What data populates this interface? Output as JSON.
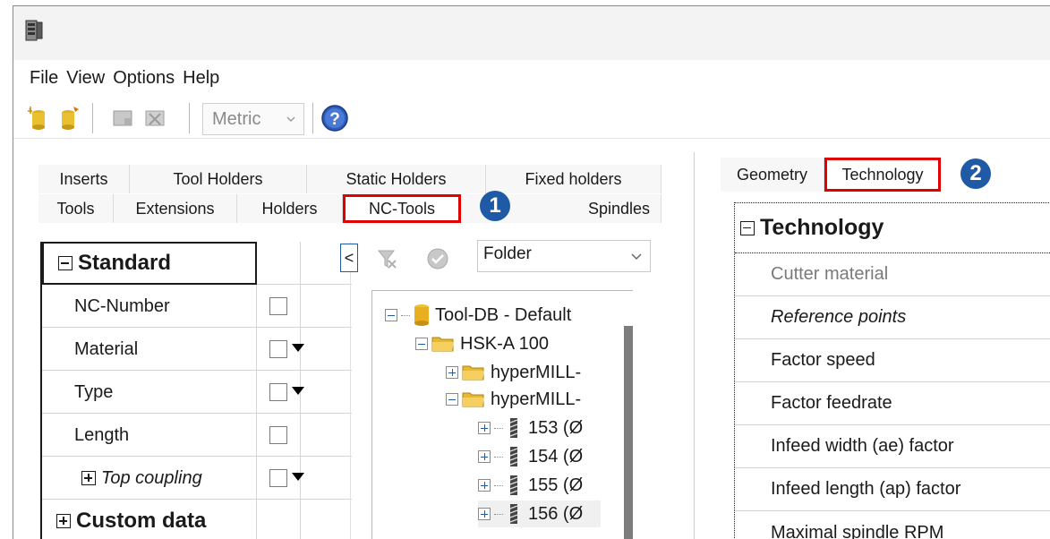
{
  "menu": [
    "File",
    "View",
    "Options",
    "Help"
  ],
  "toolbar": {
    "unit_value": "Metric"
  },
  "left_tabs": {
    "row1": [
      "Inserts",
      "Tool Holders",
      "Static Holders",
      "Fixed holders"
    ],
    "row2": [
      "Tools",
      "Extensions",
      "Holders",
      "NC-Tools",
      "Spindles"
    ],
    "active": "NC-Tools",
    "badge": "1"
  },
  "properties": {
    "category": "Standard",
    "rows": [
      {
        "label": "NC-Number",
        "dropdown": false
      },
      {
        "label": "Material",
        "dropdown": true
      },
      {
        "label": "Type",
        "dropdown": true
      },
      {
        "label": "Length",
        "dropdown": false
      },
      {
        "label": "Top coupling",
        "dropdown": true
      }
    ],
    "category2": "Custom data"
  },
  "tree_panel": {
    "nav_glyph": "<",
    "folder_select": "Folder",
    "nodes": [
      {
        "label": "Tool-DB - Default"
      },
      {
        "label": "HSK-A 100"
      },
      {
        "label": "hyperMILL-"
      },
      {
        "label": "hyperMILL-"
      },
      {
        "label": "153  (Ø"
      },
      {
        "label": "154  (Ø"
      },
      {
        "label": "155  (Ø"
      },
      {
        "label": "156  (Ø"
      }
    ]
  },
  "right_tabs": {
    "items": [
      "Geometry",
      "Technology"
    ],
    "active": "Technology",
    "badge": "2"
  },
  "technology": {
    "header": "Technology",
    "rows": [
      "Cutter material",
      "Reference points",
      "Factor speed",
      "Factor feedrate",
      "Infeed width (ae) factor",
      "Infeed length (ap) factor",
      "Maximal spindle RPM"
    ]
  },
  "colors": {
    "highlight": "#e00000",
    "badge": "#1f5aa6"
  }
}
